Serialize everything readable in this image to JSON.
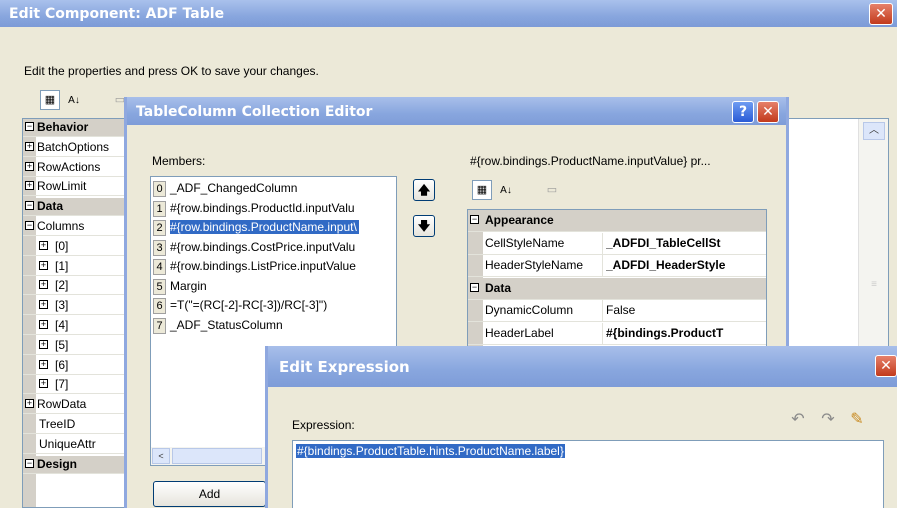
{
  "edit_component": {
    "title": "Edit Component: ADF Table",
    "close_glyph": "✕",
    "instructions": "Edit the properties and press OK to save your changes.",
    "toolbar": {
      "categorized_icon": "categorized-icon",
      "alphabetical_icon": "alphabetical-icon",
      "property_pages_icon": "property-pages-icon"
    },
    "properties": [
      {
        "label": "Behavior",
        "kind": "category",
        "expander": "⊟"
      },
      {
        "label": "BatchOptions",
        "kind": "expandable",
        "expander": "⊞"
      },
      {
        "label": "RowActions",
        "kind": "expandable",
        "expander": "⊞"
      },
      {
        "label": "RowLimit",
        "kind": "expandable",
        "expander": "⊞"
      },
      {
        "label": "Data",
        "kind": "category",
        "expander": "⊟"
      },
      {
        "label": "Columns",
        "kind": "expanded",
        "expander": "⊟"
      },
      {
        "label": "[0]",
        "kind": "child",
        "expander": "⊞"
      },
      {
        "label": "[1]",
        "kind": "child",
        "expander": "⊞"
      },
      {
        "label": "[2]",
        "kind": "child",
        "expander": "⊞"
      },
      {
        "label": "[3]",
        "kind": "child",
        "expander": "⊞"
      },
      {
        "label": "[4]",
        "kind": "child",
        "expander": "⊞"
      },
      {
        "label": "[5]",
        "kind": "child",
        "expander": "⊞"
      },
      {
        "label": "[6]",
        "kind": "child",
        "expander": "⊞"
      },
      {
        "label": "[7]",
        "kind": "child",
        "expander": "⊞"
      },
      {
        "label": "RowData",
        "kind": "expandable",
        "expander": "⊞"
      },
      {
        "label": "TreeID",
        "kind": "plain",
        "expander": ""
      },
      {
        "label": "UniqueAttr",
        "kind": "plain",
        "expander": ""
      },
      {
        "label": "Design",
        "kind": "category",
        "expander": "⊟"
      }
    ]
  },
  "collection_editor": {
    "title": "TableColumn Collection Editor",
    "help_glyph": "?",
    "close_glyph": "✕",
    "members_label": "Members:",
    "members": [
      {
        "index": "0",
        "text": "_ADF_ChangedColumn",
        "selected": false
      },
      {
        "index": "1",
        "text": "#{row.bindings.ProductId.inputValu",
        "selected": false
      },
      {
        "index": "2",
        "text": "#{row.bindings.ProductName.input\\",
        "selected": true
      },
      {
        "index": "3",
        "text": "#{row.bindings.CostPrice.inputValu",
        "selected": false
      },
      {
        "index": "4",
        "text": "#{row.bindings.ListPrice.inputValue",
        "selected": false
      },
      {
        "index": "5",
        "text": "Margin",
        "selected": false
      },
      {
        "index": "6",
        "text": "=T(\"=(RC[-2]-RC[-3])/RC[-3]\")",
        "selected": false
      },
      {
        "index": "7",
        "text": "_ADF_StatusColumn",
        "selected": false
      }
    ],
    "move_up_glyph": "🡅",
    "move_down_glyph": "🡇",
    "add_label": "Add",
    "properties_header": "#{row.bindings.ProductName.inputValue} pr...",
    "properties": [
      {
        "key": "Appearance",
        "value": "",
        "category": true,
        "bold_value": false
      },
      {
        "key": "CellStyleName",
        "value": "_ADFDI_TableCellSt",
        "category": false,
        "bold_value": true
      },
      {
        "key": "HeaderStyleName",
        "value": "_ADFDI_HeaderStyle",
        "category": false,
        "bold_value": true
      },
      {
        "key": "Data",
        "value": "",
        "category": true,
        "bold_value": false
      },
      {
        "key": "DynamicColumn",
        "value": "False",
        "category": false,
        "bold_value": false
      },
      {
        "key": "HeaderLabel",
        "value": "#{bindings.ProductT",
        "category": false,
        "bold_value": true
      }
    ]
  },
  "edit_expression": {
    "title": "Edit Expression",
    "close_glyph": "✕",
    "expression_label": "Expression:",
    "expression_value": "#{bindings.ProductTable.hints.ProductName.label}",
    "icons": [
      "undo-icon",
      "redo-icon",
      "eraser-icon"
    ]
  }
}
